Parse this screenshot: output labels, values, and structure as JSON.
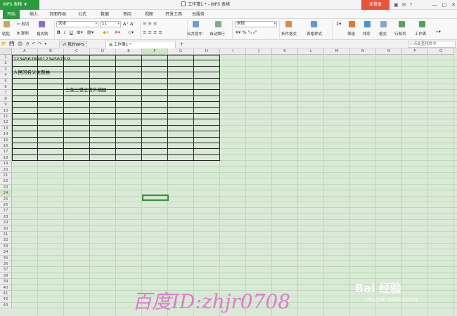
{
  "titlebar": {
    "app_label": "WPS 表格",
    "window_title": "工作簿1 * - WPS 表格",
    "login_label": "未登录"
  },
  "menu_tabs": [
    "开始",
    "插入",
    "页面布局",
    "公式",
    "数据",
    "审阅",
    "视图",
    "开发工具",
    "云服务"
  ],
  "ribbon": {
    "paste": "粘贴",
    "cut": "剪切",
    "copy": "复制",
    "format_painter": "格式刷",
    "font_name": "宋体",
    "font_size": "11",
    "merge_center": "合并居中",
    "wrap_text": "自动换行",
    "number_format": "常规",
    "conditional_format": "条件格式",
    "table_style": "表格样式",
    "filter": "筛选",
    "sort": "排序",
    "format": "格式",
    "rows_cols": "行和列",
    "worksheet": "工作表"
  },
  "quickbar": {
    "tab_mywps": "我的WPS",
    "tab_workbook": "工作簿1 *",
    "search_placeholder": "点此查找命令"
  },
  "sheet": {
    "columns": [
      "A",
      "B",
      "C",
      "D",
      "E",
      "F",
      "G",
      "H",
      "I",
      "J",
      "K",
      "L",
      "M",
      "N",
      "O",
      "P",
      "Q"
    ],
    "rows": [
      "1",
      "2",
      "3",
      "4",
      "5",
      "6",
      "7",
      "8",
      "9",
      "10",
      "11",
      "12",
      "13",
      "14",
      "15",
      "16",
      "17",
      "18",
      "19",
      "20",
      "21",
      "22",
      "23",
      "24",
      "25",
      "26",
      "27",
      "28",
      "29",
      "30",
      "31",
      "32",
      "33",
      "34",
      "35",
      "36",
      "37",
      "38",
      "39",
      "40",
      "41",
      "42",
      "43"
    ],
    "cell_a1": "123456789012345678 9",
    "cell_a3": "人民的名义主题曲",
    "cell_c6": "三生三世之世外桃园",
    "selected_cell": "F24"
  },
  "watermark": {
    "text": "百度ID:zhjr0708",
    "logo": "Bai 经验",
    "url": "jingyan.baidu.com"
  }
}
